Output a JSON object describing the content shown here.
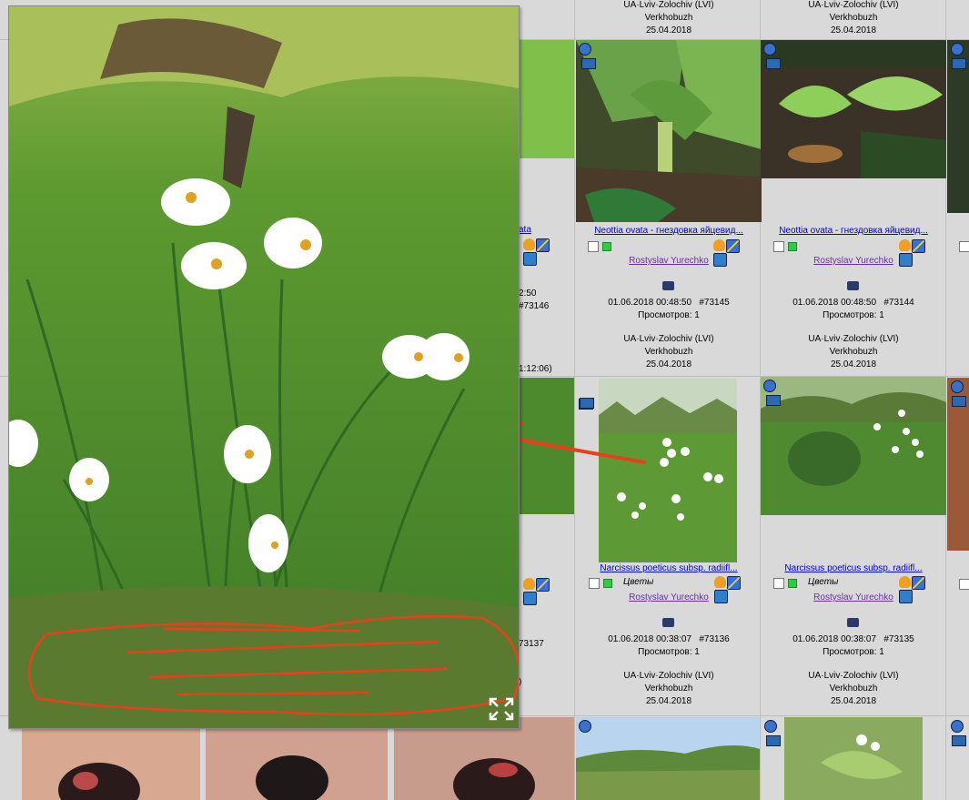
{
  "gallery": {
    "top_row": [
      {
        "location": "UA·Lviv·Zolochiv (LVI)",
        "place": "Verkhobuzh",
        "date": "25.04.2018"
      },
      {
        "location": "UA·Lviv·Zolochiv (LVI)",
        "place": "Verkhobuzh",
        "date": "25.04.2018"
      }
    ],
    "row1": [
      {
        "title": "Neottia ovata - гнездовка яйцевид...",
        "category": "",
        "author": "Rostyslav Yurechko",
        "datetime": "01.06.2018 00:48:50",
        "id": "#73145",
        "views": "Просмотров: 1",
        "location": "UA·Lviv·Zolochiv (LVI)",
        "place": "Verkhobuzh",
        "date": "25.04.2018"
      },
      {
        "title": "Neottia ovata - гнездовка яйцевид...",
        "category": "",
        "author": "Rostyslav Yurechko",
        "datetime": "01.06.2018 00:48:50",
        "id": "#73144",
        "views": "Просмотров: 1",
        "location": "UA·Lviv·Zolochiv (LVI)",
        "place": "Verkhobuzh",
        "date": "25.04.2018"
      }
    ],
    "row2": [
      {
        "title": "Narcissus poeticus subsp. radiifl...",
        "category": "Цветы",
        "author": "Rostyslav Yurechko",
        "datetime": "01.06.2018 00:38:07",
        "id": "#73136",
        "views": "Просмотров: 1",
        "location": "UA·Lviv·Zolochiv (LVI)",
        "place": "Verkhobuzh",
        "date": "25.04.2018"
      },
      {
        "title": "Narcissus poeticus subsp. radiifl...",
        "category": "Цветы",
        "author": "Rostyslav Yurechko",
        "datetime": "01.06.2018 00:38:07",
        "id": "#73135",
        "views": "Просмотров: 1",
        "location": "UA·Lviv·Zolochiv (LVI)",
        "place": "Verkhobuzh",
        "date": "25.04.2018"
      }
    ],
    "partial_left": {
      "title_fragment": "ata",
      "time_fragment": "2:50",
      "id_fragment": "#73146",
      "datetime_fragment": "1:12:06)",
      "id_fragment_2": "73137",
      "paren_fragment": ")"
    }
  },
  "popup": {
    "fullscreen_icon": "fullscreen-expand-icon"
  },
  "icons": {
    "zoom": "zoom-in-icon",
    "gps": "gps-icon",
    "favorite": "favorite-heart-icon",
    "edit": "edit-icon",
    "save": "save-icon",
    "camera": "camera-icon"
  },
  "colors": {
    "link": "#0000cc",
    "author": "#663399",
    "annotation": "#e8401c",
    "status_green": "#2ecc40"
  }
}
